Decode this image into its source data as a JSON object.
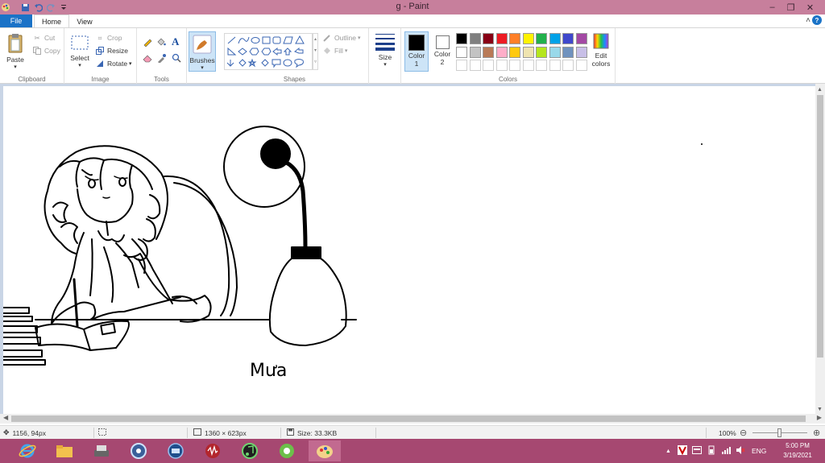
{
  "window": {
    "title": "g - Paint",
    "controls": {
      "minimize": "–",
      "restore": "❐",
      "close": "✕"
    }
  },
  "tabs": {
    "file": "File",
    "home": "Home",
    "view": "View"
  },
  "ribbon": {
    "clipboard": {
      "group": "Clipboard",
      "paste": "Paste",
      "cut": "Cut",
      "copy": "Copy"
    },
    "image": {
      "group": "Image",
      "select": "Select",
      "crop": "Crop",
      "resize": "Resize",
      "rotate": "Rotate"
    },
    "tools": {
      "group": "Tools"
    },
    "brushes": {
      "label": "Brushes"
    },
    "shapes": {
      "group": "Shapes",
      "outline": "Outline",
      "fill": "Fill"
    },
    "size": {
      "label": "Size"
    },
    "colors": {
      "group": "Colors",
      "color1_label": "Color",
      "color1_num": "1",
      "color2_label": "Color",
      "color2_num": "2",
      "edit_label1": "Edit",
      "edit_label2": "colors",
      "palette_row1": [
        "#000000",
        "#7f7f7f",
        "#880015",
        "#ed1c24",
        "#ff7f27",
        "#fff200",
        "#22b14c",
        "#00a2e8",
        "#3f48cc",
        "#a349a4"
      ],
      "palette_row2": [
        "#ffffff",
        "#c3c3c3",
        "#b97a57",
        "#ffaec9",
        "#ffc90e",
        "#efe4b0",
        "#b5e61d",
        "#99d9ea",
        "#7092be",
        "#c8bfe7"
      ],
      "color1": "#000000",
      "color2": "#ffffff",
      "accent": "#1a73c7"
    }
  },
  "canvas": {
    "signature": "Mưa"
  },
  "statusbar": {
    "cursor_pos": "1156, 94px",
    "image_size": "1360 × 623px",
    "file_size": "Size: 33.3KB",
    "zoom": "100%"
  },
  "taskbar": {
    "tray": {
      "language": "ENG"
    },
    "clock": {
      "time": "5:00 PM",
      "date": "3/19/2021"
    }
  }
}
